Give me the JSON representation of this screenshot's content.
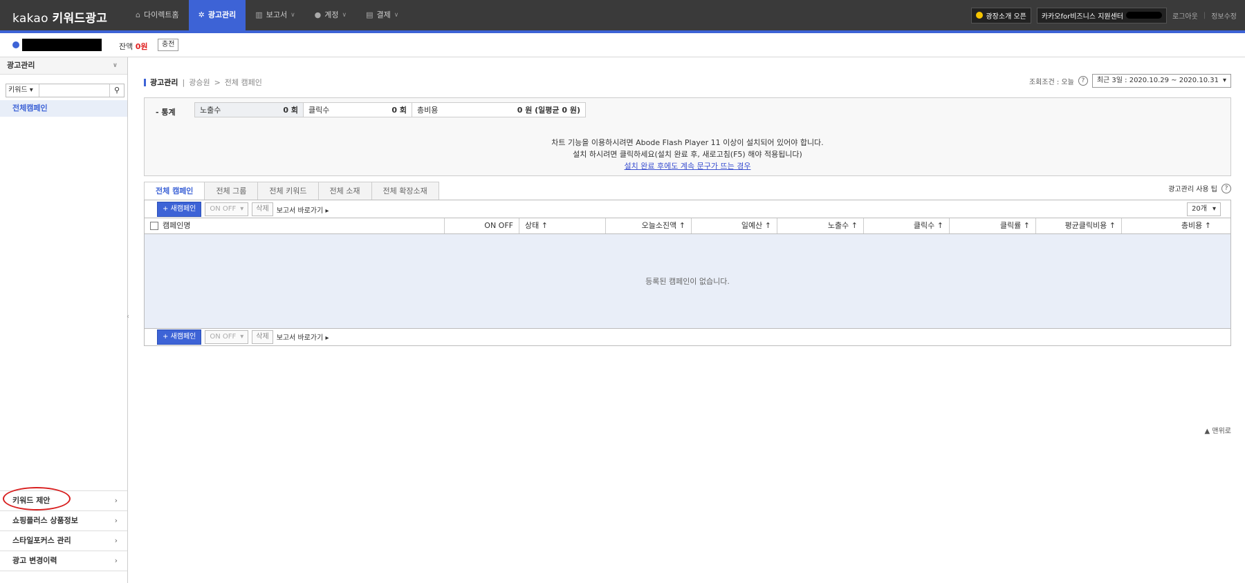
{
  "app": {
    "logo_brand": "kakao",
    "logo_product": "키워드광고"
  },
  "nav": [
    {
      "label": "다이렉트홈",
      "icon": "home-icon",
      "active": false,
      "dropdown": false
    },
    {
      "label": "광고관리",
      "icon": "gear-icon",
      "active": true,
      "dropdown": false
    },
    {
      "label": "보고서",
      "icon": "chart-icon",
      "active": false,
      "dropdown": true
    },
    {
      "label": "계정",
      "icon": "user-icon",
      "active": false,
      "dropdown": true
    },
    {
      "label": "결제",
      "icon": "card-icon",
      "active": false,
      "dropdown": true
    }
  ],
  "topright": {
    "notice": "광장소개 오픈",
    "center": "카카오for비즈니스 지원센터",
    "logout": "로그아웃",
    "edit_info": "정보수정"
  },
  "account": {
    "balance_label": "잔액",
    "balance_value": "0원",
    "charge_button": "충전"
  },
  "sidebar": {
    "header": "광고관리",
    "search_select": "키워드",
    "all_campaigns": "전체캠페인",
    "bottom_items": [
      "키워드 제안",
      "쇼핑플러스 상품정보",
      "스타일포커스 관리",
      "광고 변경이력"
    ]
  },
  "breadcrumb": {
    "current": "광고관리",
    "path1": "광승원",
    "sep": ">",
    "path2": "전체 캠페인"
  },
  "condition": {
    "label": "조회조건 : 오늘",
    "date_range": "최근 3일 : 2020.10.29 ~ 2020.10.31"
  },
  "stats": {
    "label": "- 통계",
    "impressions_label": "노출수",
    "impressions_value": "0 회",
    "clicks_label": "클릭수",
    "clicks_value": "0 회",
    "cost_label": "총비용",
    "cost_value": "0 원 (일평균 0 원)",
    "flash_line1": "차트 기능을 이용하시려면 Abode Flash Player 11 이상이 설치되어 있어야 합니다.",
    "flash_line2": "설치 하시려면 클릭하세요(설치 완료 후, 새로고침(F5) 해야 적용됩니다)",
    "flash_link": "설치 완료 후에도 계속 문구가 뜨는 경우"
  },
  "tip": "광고관리 사용 팁",
  "tabs": [
    "전체 캠페인",
    "전체 그룹",
    "전체 키워드",
    "전체 소재",
    "전체 확장소재"
  ],
  "toolbar": {
    "new_campaign": "+ 새캠페인",
    "onoff": "ON OFF",
    "delete": "삭제",
    "report": "보고서 바로가기 ▸",
    "per_page": "20개"
  },
  "table": {
    "columns": [
      "캠페인명",
      "ON OFF",
      "상태 ↑",
      "오늘소진액 ↑",
      "일예산 ↑",
      "노출수 ↑",
      "클릭수 ↑",
      "클릭률 ↑",
      "평균클릭비용 ↑",
      "총비용 ↑"
    ],
    "empty_message": "등록된 캠페인이 없습니다."
  },
  "top_link": "▲ 맨위로"
}
